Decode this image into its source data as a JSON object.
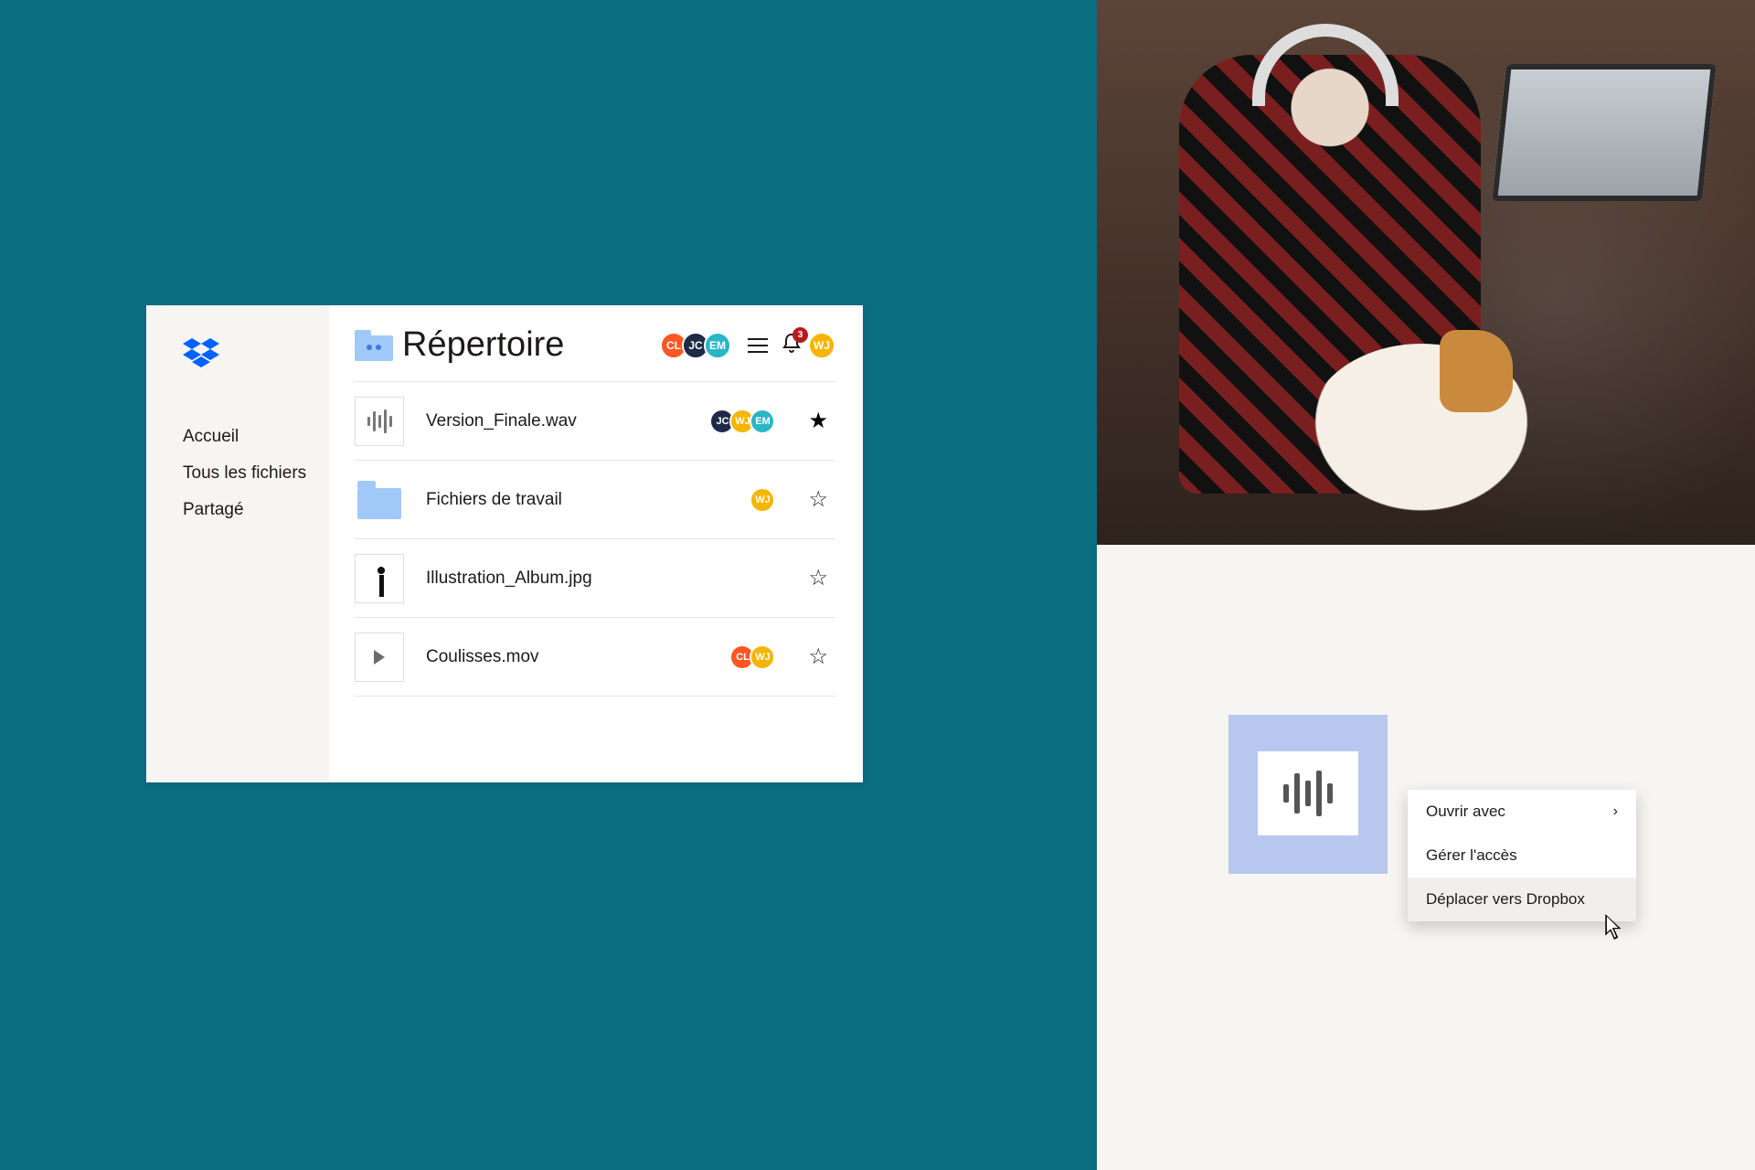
{
  "sidebar": {
    "nav": [
      "Accueil",
      "Tous les fichiers",
      "Partagé"
    ]
  },
  "header": {
    "title": "Répertoire",
    "avatars": [
      {
        "initials": "CL",
        "color": "av-orange"
      },
      {
        "initials": "JC",
        "color": "av-navy"
      },
      {
        "initials": "EM",
        "color": "av-teal"
      }
    ],
    "notification_count": "3",
    "user_avatar": {
      "initials": "WJ",
      "color": "av-yellow"
    }
  },
  "files": [
    {
      "name": "Version_Finale.wav",
      "thumb": "audio",
      "avatars": [
        {
          "initials": "JC",
          "color": "av-navy"
        },
        {
          "initials": "WJ",
          "color": "av-yellow"
        },
        {
          "initials": "EM",
          "color": "av-teal"
        }
      ],
      "starred": true
    },
    {
      "name": "Fichiers de travail",
      "thumb": "folder",
      "avatars": [
        {
          "initials": "WJ",
          "color": "av-yellow"
        }
      ],
      "starred": false
    },
    {
      "name": "Illustration_Album.jpg",
      "thumb": "image",
      "avatars": [],
      "starred": false
    },
    {
      "name": "Coulisses.mov",
      "thumb": "video",
      "avatars": [
        {
          "initials": "CL",
          "color": "av-orange"
        },
        {
          "initials": "WJ",
          "color": "av-yellow"
        }
      ],
      "starred": false
    }
  ],
  "context_menu": {
    "items": [
      {
        "label": "Ouvrir avec",
        "submenu": true,
        "hover": false
      },
      {
        "label": "Gérer l'accès",
        "submenu": false,
        "hover": false
      },
      {
        "label": "Déplacer vers Dropbox",
        "submenu": false,
        "hover": true
      }
    ]
  }
}
